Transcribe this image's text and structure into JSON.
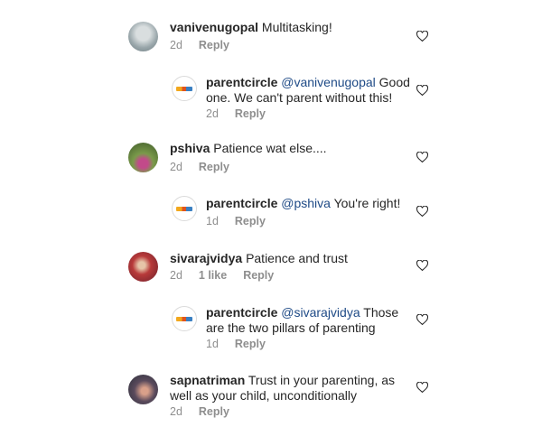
{
  "comments": [
    {
      "type": "top",
      "username": "vanivenugopal",
      "text": "Multitasking!",
      "time": "2d",
      "reply_label": "Reply",
      "avatar_color": "#b8c4c9"
    },
    {
      "type": "reply",
      "username": "parentcircle",
      "mention": "@vanivenugopal",
      "text": "Good one. We can't parent without this!",
      "time": "2d",
      "reply_label": "Reply"
    },
    {
      "type": "top",
      "username": "pshiva",
      "text": "Patience wat else....",
      "time": "2d",
      "reply_label": "Reply",
      "avatar_color": "#6f8a3f"
    },
    {
      "type": "reply",
      "username": "parentcircle",
      "mention": "@pshiva",
      "text": "You're right!",
      "time": "1d",
      "reply_label": "Reply"
    },
    {
      "type": "top",
      "username": "sivarajvidya",
      "text": "Patience and trust",
      "time": "2d",
      "likes": "1 like",
      "reply_label": "Reply",
      "avatar_color": "#9b2a2a"
    },
    {
      "type": "reply",
      "username": "parentcircle",
      "mention": "@sivarajvidya",
      "text": "Those are the two pillars of parenting",
      "time": "1d",
      "reply_label": "Reply"
    },
    {
      "type": "top",
      "username": "sapnatriman",
      "text": "Trust in your parenting, as well as your child, unconditionally",
      "time": "2d",
      "reply_label": "Reply",
      "avatar_color": "#4a4f5c"
    }
  ],
  "icons": {
    "like": "heart-outline-icon"
  },
  "colors": {
    "mention": "#1e4a86",
    "meta": "#8e8e8e",
    "text": "#262626"
  }
}
